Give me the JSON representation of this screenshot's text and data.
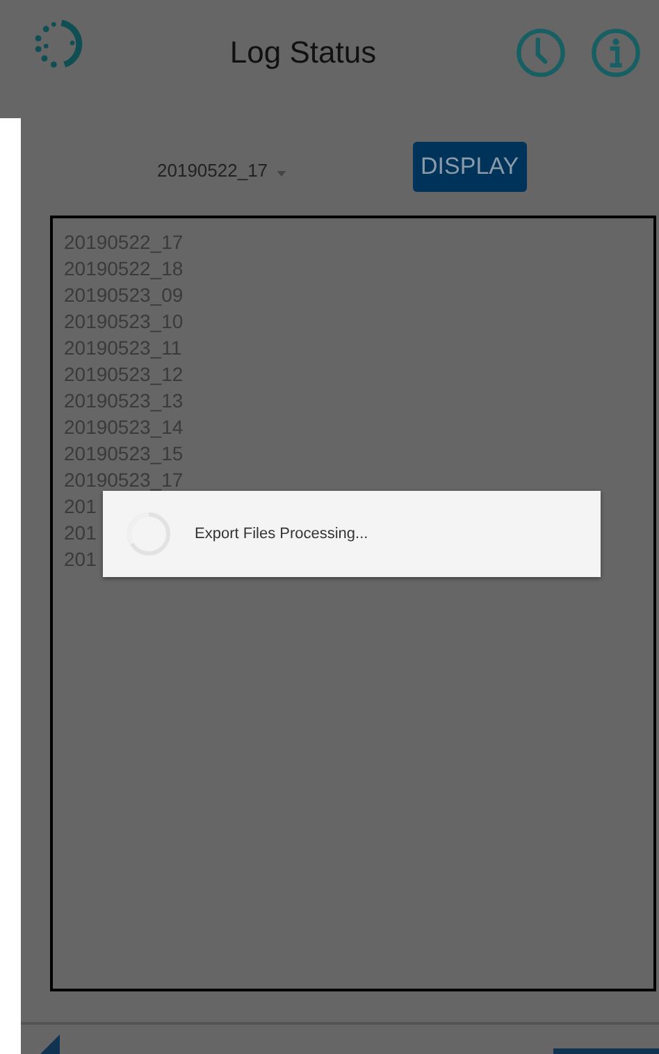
{
  "app_bar": {
    "title": "Log Status"
  },
  "controls": {
    "selected_log": "20190522_17",
    "display_button": "DISPLAY"
  },
  "log_list": [
    "20190522_17",
    "20190522_18",
    "20190523_09",
    "20190523_10",
    "20190523_11",
    "20190523_12",
    "20190523_13",
    "20190523_14",
    "20190523_15",
    "20190523_17",
    "201",
    "201",
    "201"
  ],
  "progress_dialog": {
    "message": "Export Files Processing..."
  }
}
